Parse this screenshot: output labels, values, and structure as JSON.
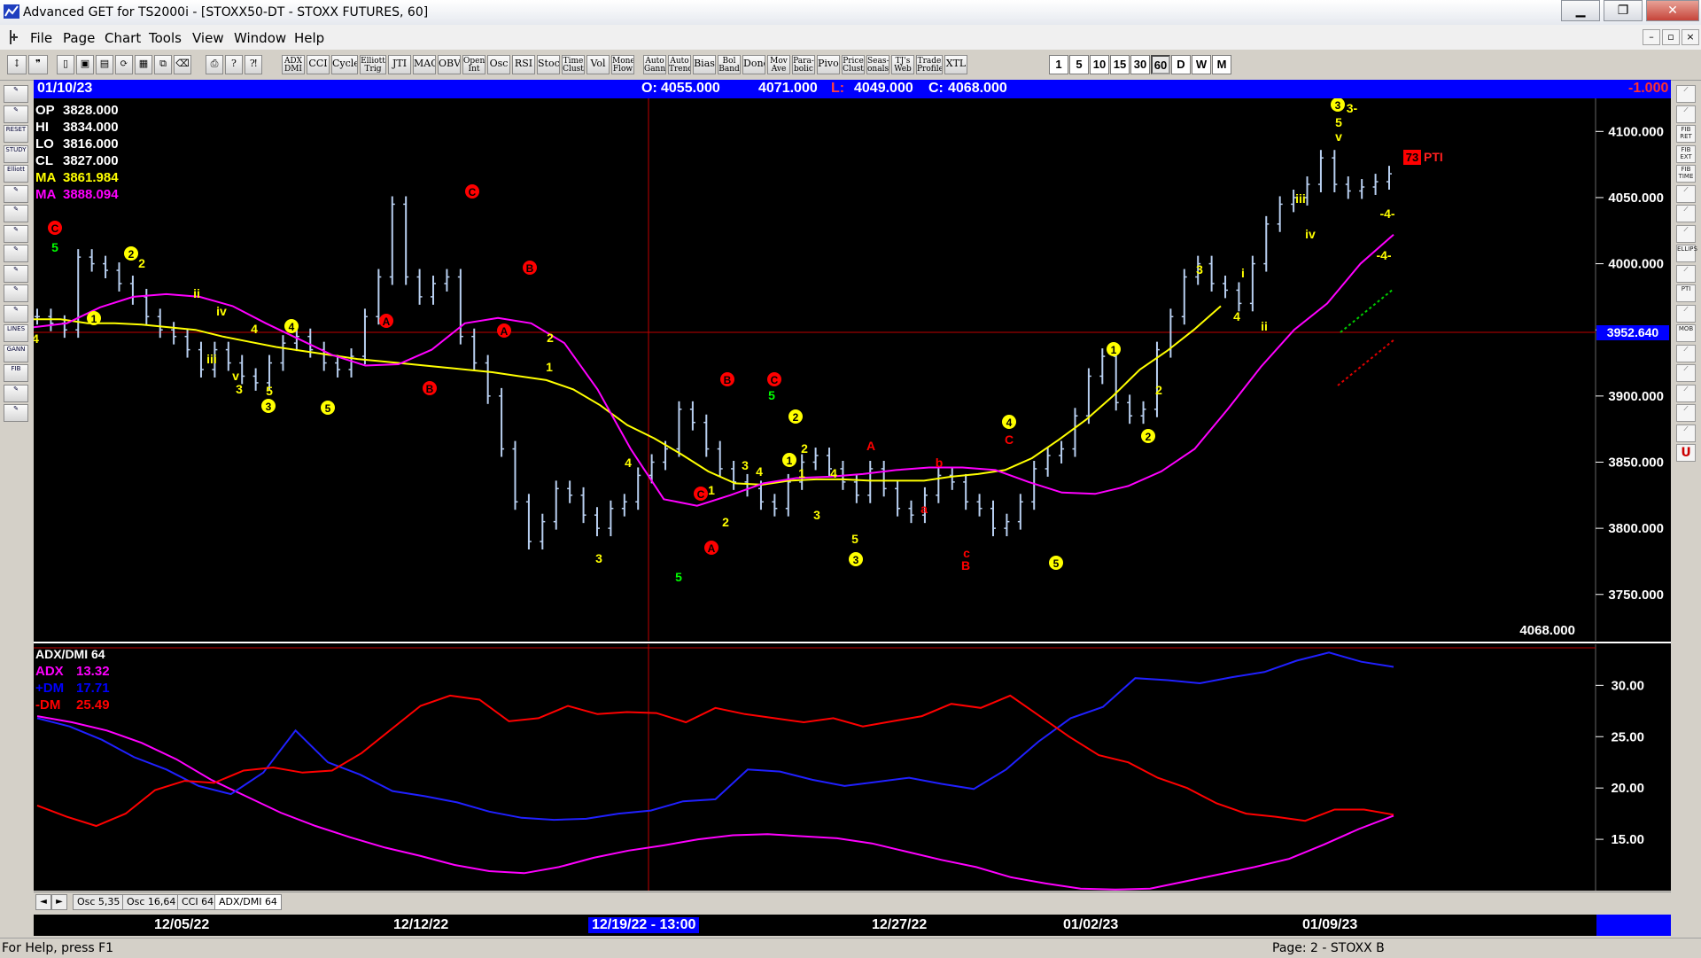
{
  "window": {
    "title": "Advanced GET for TS2000i - [STOXX50-DT - STOXX FUTURES, 60]",
    "controls": {
      "minimize": "▁",
      "restore": "❐",
      "close": "✕"
    }
  },
  "menubar": {
    "items": [
      "File",
      "Page",
      "Chart",
      "Tools",
      "View",
      "Window",
      "Help"
    ],
    "mdi": {
      "minimize": "–",
      "restore": "▫",
      "close": "×"
    }
  },
  "toolbar": {
    "study_buttons": [
      [
        "ADX",
        "DMI"
      ],
      [
        "CCI"
      ],
      [
        "Cycles"
      ],
      [
        "Elliott",
        "Trig"
      ],
      [
        "JTI"
      ],
      [
        "MACD"
      ],
      [
        "OBV"
      ],
      [
        "Open",
        "Int"
      ],
      [
        "Osc"
      ],
      [
        "RSI"
      ],
      [
        "Stoch"
      ],
      [
        "Time",
        "Clust"
      ],
      [
        "Vol"
      ],
      [
        "Money",
        "Flow"
      ],
      [
        "Auto",
        "Gann"
      ],
      [
        "Auto",
        "Trend"
      ],
      [
        "Bias"
      ],
      [
        "Bol",
        "Band"
      ],
      [
        "Donch"
      ],
      [
        "Mov",
        "Ave"
      ],
      [
        "Para-",
        "bolic"
      ],
      [
        "Pivot"
      ],
      [
        "Price",
        "Clust"
      ],
      [
        "Seas-",
        "onals"
      ],
      [
        "TJ's",
        "Web"
      ],
      [
        "Trade",
        "Profile"
      ],
      [
        "XTL"
      ]
    ],
    "timeframes": [
      "1",
      "5",
      "10",
      "15",
      "30",
      "60",
      "D",
      "W",
      "M"
    ],
    "active_timeframe": "60"
  },
  "left_toolbar": {
    "labels": [
      "",
      "",
      "RESET",
      "STUDY",
      "Elliott",
      "",
      "",
      "",
      "",
      "",
      "",
      "",
      "LINES",
      "GANN",
      "FIB",
      "",
      ""
    ]
  },
  "right_toolbar": {
    "labels": [
      "",
      "",
      "FIB RET",
      "FIB EXT",
      "FIB TIME",
      "",
      "",
      "",
      "ELLIPS",
      "",
      "PTI",
      "",
      "MOB",
      "",
      "",
      "",
      "",
      "",
      "U"
    ]
  },
  "header_bar": {
    "date": "01/10/23",
    "open_label": "O:",
    "open": "4055.000",
    "high": "4071.000",
    "low_label": "L:",
    "low": "4049.000",
    "close_label": "C:",
    "close": "4068.000",
    "change": "-1.000"
  },
  "price_panel": {
    "readout": [
      {
        "label": "OP",
        "value": "3828.000",
        "color": "#ffffff"
      },
      {
        "label": "HI",
        "value": "3834.000",
        "color": "#ffffff"
      },
      {
        "label": "LO",
        "value": "3816.000",
        "color": "#ffffff"
      },
      {
        "label": "CL",
        "value": "3827.000",
        "color": "#ffffff"
      },
      {
        "label": "MA",
        "value": "3861.984",
        "color": "#ffff00"
      },
      {
        "label": "MA",
        "value": "3888.094",
        "color": "#ff00ff"
      }
    ],
    "axis_ticks": [
      "4100.000",
      "4050.000",
      "4000.000",
      "3950.000",
      "3900.000",
      "3850.000",
      "3800.000",
      "3750.000"
    ],
    "crosshair_price": "3952.640",
    "last_price": "4068.000",
    "pti_value": "73",
    "pti_label": "PTI"
  },
  "wave_labels": [
    {
      "t": "4",
      "c": "#ffff00"
    },
    {
      "t": "C",
      "c": "#ff0000",
      "circle": true
    },
    {
      "t": "5",
      "c": "#00ff00"
    },
    {
      "t": "1",
      "c": "#ffff00",
      "circle": true
    },
    {
      "t": "2",
      "c": "#ffff00",
      "circle": true
    },
    {
      "t": "2",
      "c": "#ffff00"
    },
    {
      "t": "ii",
      "c": "#ffff00"
    },
    {
      "t": "iv",
      "c": "#ffff00"
    },
    {
      "t": "iii",
      "c": "#ffff00"
    },
    {
      "t": "v",
      "c": "#ffff00"
    },
    {
      "t": "3",
      "c": "#ffff00"
    },
    {
      "t": "4",
      "c": "#ffff00"
    },
    {
      "t": "4",
      "c": "#ffff00",
      "circle": true
    },
    {
      "t": "5",
      "c": "#ffff00"
    },
    {
      "t": "3",
      "c": "#ffff00",
      "circle": true
    },
    {
      "t": "5",
      "c": "#ffff00",
      "circle": true
    },
    {
      "t": "A",
      "c": "#ff0000",
      "circle": true
    },
    {
      "t": "B",
      "c": "#ff0000",
      "circle": true
    },
    {
      "t": "C",
      "c": "#ff0000",
      "circle": true
    },
    {
      "t": "B",
      "c": "#ff0000",
      "circle": true
    },
    {
      "t": "A",
      "c": "#ff0000",
      "circle": true
    },
    {
      "t": "2",
      "c": "#ffff00"
    },
    {
      "t": "1",
      "c": "#ffff00"
    },
    {
      "t": "3",
      "c": "#ffff00"
    },
    {
      "t": "4",
      "c": "#ffff00"
    },
    {
      "t": "5",
      "c": "#00ff00"
    },
    {
      "t": "C",
      "c": "#ff0000",
      "circle": true
    },
    {
      "t": "A",
      "c": "#ff0000",
      "circle": true
    },
    {
      "t": "B",
      "c": "#ff0000",
      "circle": true
    },
    {
      "t": "1",
      "c": "#ffff00"
    },
    {
      "t": "2",
      "c": "#ffff00"
    },
    {
      "t": "3",
      "c": "#ffff00"
    },
    {
      "t": "4",
      "c": "#ffff00"
    },
    {
      "t": "C",
      "c": "#ff0000",
      "circle": true
    },
    {
      "t": "5",
      "c": "#00ff00"
    },
    {
      "t": "2",
      "c": "#ffff00",
      "circle": true
    },
    {
      "t": "1",
      "c": "#ffff00",
      "circle": true
    },
    {
      "t": "2",
      "c": "#ffff00"
    },
    {
      "t": "1",
      "c": "#ffff00"
    },
    {
      "t": "4",
      "c": "#ffff00"
    },
    {
      "t": "3",
      "c": "#ffff00"
    },
    {
      "t": "5",
      "c": "#ffff00"
    },
    {
      "t": "3",
      "c": "#ffff00",
      "circle": true
    },
    {
      "t": "A",
      "c": "#ff0000"
    },
    {
      "t": "b",
      "c": "#ff0000"
    },
    {
      "t": "a",
      "c": "#ff0000"
    },
    {
      "t": "c",
      "c": "#ff0000"
    },
    {
      "t": "B",
      "c": "#ff0000"
    },
    {
      "t": "4",
      "c": "#ffff00",
      "circle": true
    },
    {
      "t": "C",
      "c": "#ff0000"
    },
    {
      "t": "5",
      "c": "#ffff00",
      "circle": true
    },
    {
      "t": "1",
      "c": "#ffff00",
      "circle": true
    },
    {
      "t": "2",
      "c": "#ffff00",
      "circle": true
    },
    {
      "t": "2",
      "c": "#ffff00"
    },
    {
      "t": "3",
      "c": "#ffff00"
    },
    {
      "t": "i",
      "c": "#ffff00"
    },
    {
      "t": "4",
      "c": "#ffff00"
    },
    {
      "t": "ii",
      "c": "#ffff00"
    },
    {
      "t": "iii",
      "c": "#ffff00"
    },
    {
      "t": "iv",
      "c": "#ffff00"
    },
    {
      "t": "3",
      "c": "#ffff00",
      "circle": true
    },
    {
      "t": "3-",
      "c": "#ffff00"
    },
    {
      "t": "5",
      "c": "#ffff00"
    },
    {
      "t": "v",
      "c": "#ffff00"
    },
    {
      "t": "-4-",
      "c": "#ffff00"
    },
    {
      "t": "-4-",
      "c": "#ffff00"
    }
  ],
  "indicator_panel": {
    "title": "ADX/DMI 64",
    "readout": [
      {
        "label": "ADX",
        "value": "13.32",
        "color": "#ff00ff"
      },
      {
        "label": "+DM",
        "value": "17.71",
        "color": "#0000ff"
      },
      {
        "label": "-DM",
        "value": "25.49",
        "color": "#ff0000"
      }
    ],
    "axis_ticks": [
      "30.00",
      "25.00",
      "20.00",
      "15.00"
    ]
  },
  "chart_data": {
    "type": "line",
    "instrument": "STOXX50-DT - STOXX FUTURES",
    "timeframe": "60",
    "x_dates": [
      "12/05/22",
      "12/12/22",
      "12/19/22 - 13:00",
      "12/27/22",
      "01/02/23",
      "01/09/23"
    ],
    "price_ylim": [
      3715,
      4125
    ],
    "price_close_approx": [
      3960,
      3955,
      3950,
      4005,
      4000,
      3995,
      3985,
      3975,
      3960,
      3950,
      3945,
      3935,
      3920,
      3935,
      3925,
      3915,
      3910,
      3925,
      3940,
      3945,
      3935,
      3925,
      3920,
      3930,
      3960,
      3990,
      4045,
      3990,
      3975,
      3985,
      3990,
      3945,
      3925,
      3900,
      3860,
      3820,
      3790,
      3805,
      3830,
      3825,
      3810,
      3800,
      3815,
      3820,
      3840,
      3850,
      3860,
      3890,
      3880,
      3860,
      3845,
      3835,
      3830,
      3820,
      3815,
      3835,
      3850,
      3855,
      3845,
      3835,
      3825,
      3845,
      3830,
      3815,
      3810,
      3825,
      3840,
      3835,
      3820,
      3815,
      3800,
      3805,
      3820,
      3845,
      3855,
      3860,
      3885,
      3915,
      3930,
      3895,
      3885,
      3890,
      3935,
      3960,
      3990,
      4000,
      3985,
      3980,
      3970,
      4000,
      4030,
      4045,
      4050,
      4060,
      4080,
      4060,
      4055,
      4058,
      4062,
      4068
    ],
    "ma_yellow": [
      3958,
      3958,
      3955,
      3955,
      3954,
      3952,
      3950,
      3945,
      3941,
      3937,
      3934,
      3931,
      3928,
      3926,
      3924,
      3922,
      3920,
      3918,
      3915,
      3912,
      3905,
      3893,
      3878,
      3868,
      3856,
      3843,
      3834,
      3833,
      3836,
      3837,
      3837,
      3836,
      3836,
      3836,
      3839,
      3841,
      3844,
      3853,
      3867,
      3882,
      3900,
      3920,
      3934,
      3950,
      3968
    ],
    "ma_magenta": [
      3952,
      3955,
      3967,
      3975,
      3977,
      3975,
      3968,
      3955,
      3943,
      3931,
      3923,
      3924,
      3935,
      3955,
      3959,
      3955,
      3940,
      3905,
      3860,
      3822,
      3817,
      3825,
      3834,
      3838,
      3839,
      3841,
      3844,
      3846,
      3846,
      3844,
      3835,
      3827,
      3826,
      3832,
      3843,
      3860,
      3890,
      3922,
      3950,
      3970,
      4000,
      4022
    ],
    "ind_ylim": [
      10,
      34
    ],
    "adx": [
      27,
      26.4,
      25.6,
      24.4,
      22.8,
      20.8,
      19.2,
      17.6,
      16.3,
      15.2,
      14.2,
      13.4,
      12.5,
      11.9,
      11.7,
      12.3,
      13.2,
      13.9,
      14.4,
      15,
      15.4,
      15.5,
      15.3,
      15.1,
      14.6,
      13.8,
      13,
      12.3,
      11.3,
      10.7,
      10.2,
      10.1,
      10.2,
      10.9,
      11.6,
      12.3,
      13.1,
      14.5,
      16,
      17.3
    ],
    "plus_dm": [
      26.8,
      26,
      24.7,
      23,
      21.8,
      20.2,
      19.4,
      21.5,
      25.6,
      22.5,
      21.3,
      19.7,
      19.2,
      18.6,
      17.7,
      17.1,
      16.9,
      17,
      17.5,
      17.8,
      18.7,
      18.9,
      21.8,
      21.6,
      20.8,
      20.2,
      20.6,
      21,
      20.4,
      19.9,
      21.8,
      24.5,
      26.8,
      27.9,
      30.7,
      30.5,
      30.2,
      30.8,
      31.3,
      32.4,
      33.2,
      32.3,
      31.8
    ],
    "minus_dm": [
      18.3,
      17.2,
      16.3,
      17.5,
      19.8,
      20.7,
      20.5,
      21.7,
      22,
      21.5,
      21.7,
      23.4,
      25.7,
      28,
      29,
      28.6,
      26.5,
      26.8,
      28,
      27.2,
      27.4,
      27.3,
      26.4,
      27.8,
      27.2,
      26.8,
      26.4,
      26.8,
      26,
      26.5,
      27,
      28.2,
      27.8,
      29,
      27,
      25,
      23.2,
      22.5,
      21,
      20,
      18.5,
      17.5,
      17.2,
      16.8,
      17.9,
      17.9,
      17.4
    ]
  },
  "tabs": {
    "items": [
      "Osc 5,35",
      "Osc 16,64",
      "CCI 64",
      "ADX/DMI 64"
    ],
    "active": "ADX/DMI 64",
    "left_arrow": "◄",
    "right_arrow": "►"
  },
  "xaxis_labels": [
    "12/05/22",
    "12/12/22",
    "12/19/22 - 13:00",
    "12/27/22",
    "01/02/23",
    "01/09/23"
  ],
  "statusbar": {
    "help": "For Help, press F1",
    "page": "Page: 2 - STOXX B"
  }
}
